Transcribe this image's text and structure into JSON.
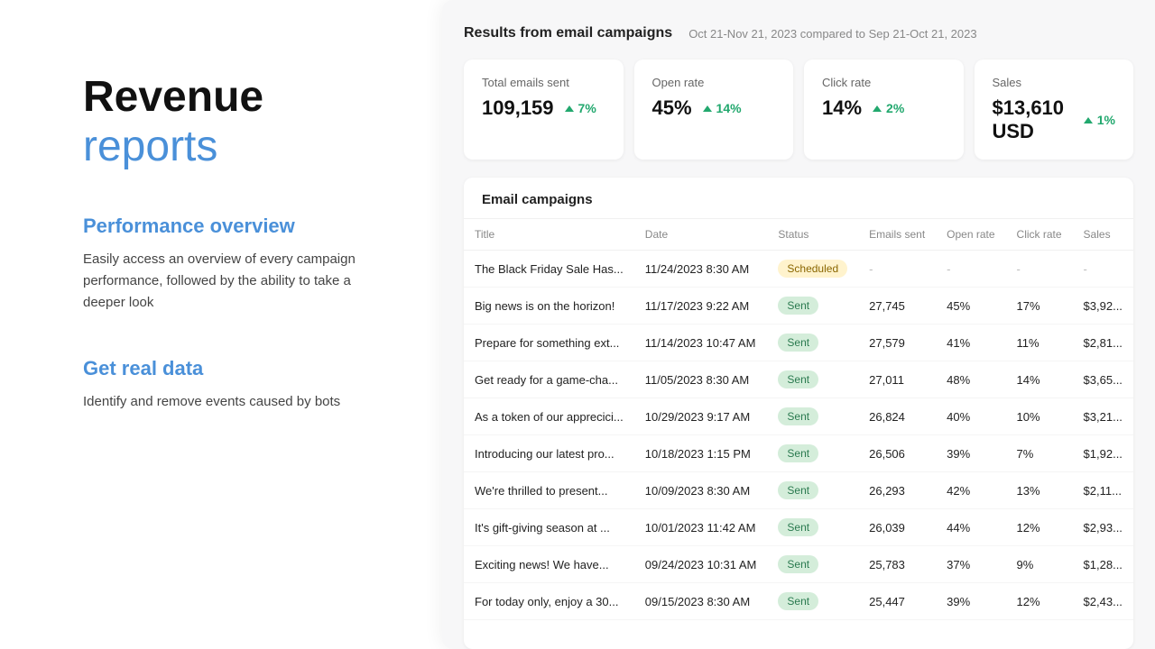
{
  "left": {
    "title_plain": "Revenue",
    "title_highlight": "reports",
    "sections": [
      {
        "heading": "Performance overview",
        "desc": "Easily access an overview of every campaign performance, followed by the ability to take a deeper look"
      },
      {
        "heading": "Get real data",
        "desc": "Identify and remove events caused by bots"
      }
    ]
  },
  "right": {
    "results_title": "Results from email campaigns",
    "results_date": "Oct 21-Nov 21, 2023 compared to Sep 21-Oct 21, 2023",
    "metrics": [
      {
        "label": "Total emails sent",
        "value": "109,159",
        "change": "7%"
      },
      {
        "label": "Open rate",
        "value": "45%",
        "change": "14%"
      },
      {
        "label": "Click rate",
        "value": "14%",
        "change": "2%"
      },
      {
        "label": "Sales",
        "value": "$13,610 USD",
        "change": "1%"
      }
    ],
    "campaigns_title": "Email campaigns",
    "table_headers": [
      "Title",
      "Date",
      "Status",
      "Emails sent",
      "Open rate",
      "Click rate",
      "Sales"
    ],
    "rows": [
      {
        "title": "The Black Friday Sale Has...",
        "date": "11/24/2023 8:30 AM",
        "status": "Scheduled",
        "emails_sent": "-",
        "open_rate": "-",
        "click_rate": "-",
        "sales": "-"
      },
      {
        "title": "Big news is on the horizon!",
        "date": "11/17/2023 9:22 AM",
        "status": "Sent",
        "emails_sent": "27,745",
        "open_rate": "45%",
        "click_rate": "17%",
        "sales": "$3,92..."
      },
      {
        "title": "Prepare for something ext...",
        "date": "11/14/2023 10:47 AM",
        "status": "Sent",
        "emails_sent": "27,579",
        "open_rate": "41%",
        "click_rate": "11%",
        "sales": "$2,81..."
      },
      {
        "title": "Get ready for a game-cha...",
        "date": "11/05/2023 8:30 AM",
        "status": "Sent",
        "emails_sent": "27,011",
        "open_rate": "48%",
        "click_rate": "14%",
        "sales": "$3,65..."
      },
      {
        "title": "As a token of our apprecici...",
        "date": "10/29/2023 9:17 AM",
        "status": "Sent",
        "emails_sent": "26,824",
        "open_rate": "40%",
        "click_rate": "10%",
        "sales": "$3,21..."
      },
      {
        "title": "Introducing our latest pro...",
        "date": "10/18/2023 1:15 PM",
        "status": "Sent",
        "emails_sent": "26,506",
        "open_rate": "39%",
        "click_rate": "7%",
        "sales": "$1,92..."
      },
      {
        "title": "We're thrilled to present...",
        "date": "10/09/2023 8:30 AM",
        "status": "Sent",
        "emails_sent": "26,293",
        "open_rate": "42%",
        "click_rate": "13%",
        "sales": "$2,11..."
      },
      {
        "title": "It's gift-giving season at ...",
        "date": "10/01/2023 11:42 AM",
        "status": "Sent",
        "emails_sent": "26,039",
        "open_rate": "44%",
        "click_rate": "12%",
        "sales": "$2,93..."
      },
      {
        "title": "Exciting news! We have...",
        "date": "09/24/2023 10:31 AM",
        "status": "Sent",
        "emails_sent": "25,783",
        "open_rate": "37%",
        "click_rate": "9%",
        "sales": "$1,28..."
      },
      {
        "title": "For today only, enjoy a 30...",
        "date": "09/15/2023 8:30 AM",
        "status": "Sent",
        "emails_sent": "25,447",
        "open_rate": "39%",
        "click_rate": "12%",
        "sales": "$2,43..."
      }
    ]
  }
}
